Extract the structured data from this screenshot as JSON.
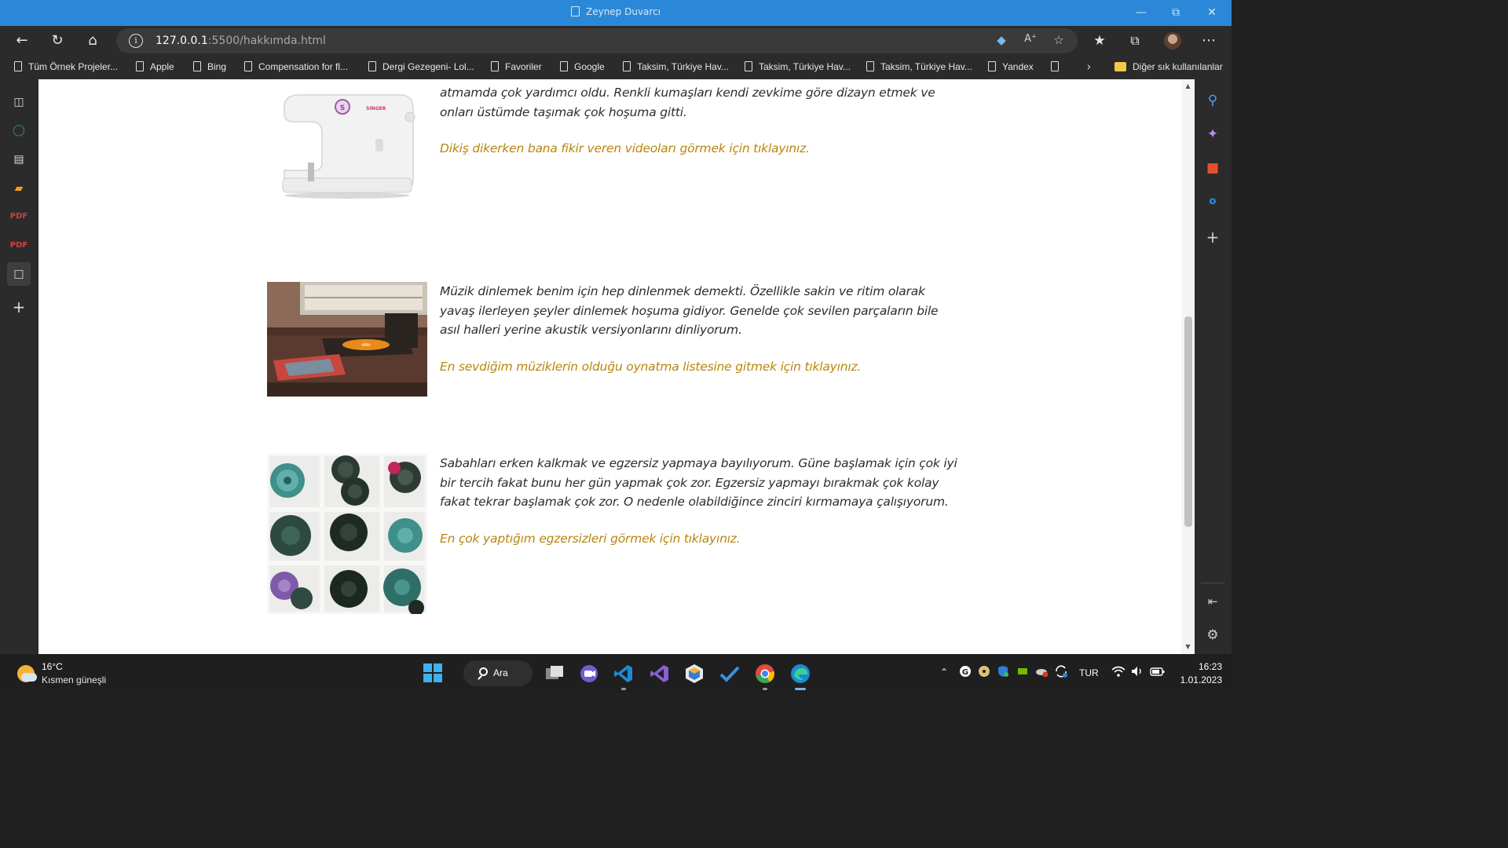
{
  "window": {
    "title": "Zeynep Duvarcı"
  },
  "toolbar": {
    "url_host": "127.0.0.1",
    "url_rest": ":5500/hakkımda.html"
  },
  "bookmarks": [
    "Tüm Örnek Projeler...",
    "Apple",
    "Bing",
    "Compensation for fl...",
    "Dergi Gezegeni- Lol...",
    "Favoriler",
    "Google",
    "Taksim, Türkiye Hav...",
    "Taksim, Türkiye Hav...",
    "Taksim, Türkiye Hav...",
    "Yandex"
  ],
  "bookmarks_other": "Diğer sık kullanılanlar",
  "content": {
    "sewing": {
      "text": "atmamda çok yardımcı oldu. Renkli kumaşları kendi zevkime göre dizayn etmek ve onları üstümde taşımak çok hoşuma gitti.",
      "link": "Dikiş dikerken bana fikir veren videoları görmek için tıklayınız.",
      "brand": "SINGER"
    },
    "music": {
      "text": "Müzik dinlemek benim için hep dinlenmek demekti. Özellikle sakin ve ritim olarak yavaş ilerleyen şeyler dinlemek hoşuma gidiyor. Genelde çok sevilen parçaların bile asıl halleri yerine akustik versiyonlarını dinliyorum.",
      "link": "En sevdiğim müziklerin olduğu oynatma listesine gitmek için tıklayınız."
    },
    "exercise": {
      "text": "Sabahları erken kalkmak ve egzersiz yapmaya bayılıyorum. Güne başlamak için çok iyi bir tercih fakat bunu her gün yapmak çok zor. Egzersiz yapmayı bırakmak çok kolay fakat tekrar başlamak çok zor. O nedenle olabildiğince zinciri kırmamaya çalışıyorum.",
      "link": "En çok yaptığım egzersizleri görmek için tıklayınız."
    }
  },
  "taskbar": {
    "temperature": "16°C",
    "weather": "Kısmen güneşli",
    "search_label": "Ara",
    "language": "TUR",
    "time": "16:23",
    "date": "1.01.2023"
  },
  "colors": {
    "titlebar": "#2b88d8",
    "link": "#b8860b",
    "body_text": "#2d2d2d"
  }
}
